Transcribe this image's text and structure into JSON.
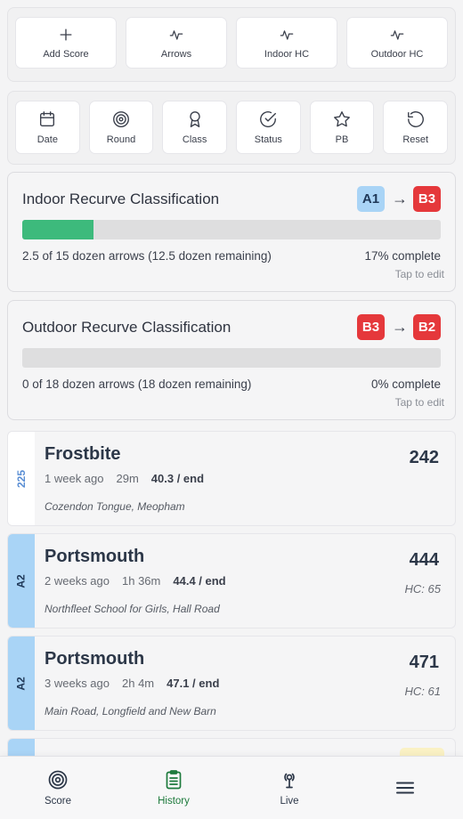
{
  "quick_actions": [
    {
      "label": "Add Score",
      "icon": "plus-icon"
    },
    {
      "label": "Arrows",
      "icon": "pulse-icon"
    },
    {
      "label": "Indoor HC",
      "icon": "pulse-icon"
    },
    {
      "label": "Outdoor HC",
      "icon": "pulse-icon"
    }
  ],
  "filters": [
    {
      "label": "Date",
      "icon": "calendar-icon"
    },
    {
      "label": "Round",
      "icon": "target-icon"
    },
    {
      "label": "Class",
      "icon": "award-icon"
    },
    {
      "label": "Status",
      "icon": "check-circle-icon"
    },
    {
      "label": "PB",
      "icon": "star-icon"
    },
    {
      "label": "Reset",
      "icon": "reset-icon"
    }
  ],
  "classifications": [
    {
      "title": "Indoor Recurve Classification",
      "from": "A1",
      "to": "B3",
      "arrow": "→",
      "progress_fraction": 0.17,
      "progress_text": "2.5 of 15 dozen arrows (12.5 dozen remaining)",
      "percent_text": "17% complete",
      "edit_text": "Tap to edit"
    },
    {
      "title": "Outdoor Recurve Classification",
      "from": "B3",
      "to": "B2",
      "arrow": "→",
      "progress_fraction": 0,
      "progress_text": "0 of 18 dozen arrows (18 dozen remaining)",
      "percent_text": "0% complete",
      "edit_text": "Tap to edit"
    }
  ],
  "scores": [
    {
      "tag": "225",
      "round": "Frostbite",
      "when": "1 week ago",
      "duration": "29m",
      "avg": "40.3 / end",
      "venue": "Cozendon Tongue, Meopham",
      "score": "242",
      "hc": ""
    },
    {
      "tag": "A2",
      "round": "Portsmouth",
      "when": "2 weeks ago",
      "duration": "1h 36m",
      "avg": "44.4 / end",
      "venue": "Northfleet School for Girls, Hall Road",
      "score": "444",
      "hc": "HC: 65"
    },
    {
      "tag": "A2",
      "round": "Portsmouth",
      "when": "3 weeks ago",
      "duration": "2h 4m",
      "avg": "47.1 / end",
      "venue": "Main Road, Longfield and New Barn",
      "score": "471",
      "hc": "HC: 61"
    }
  ],
  "nav": [
    {
      "label": "Score",
      "icon": "target-icon"
    },
    {
      "label": "History",
      "icon": "clipboard-icon",
      "active": true
    },
    {
      "label": "Live",
      "icon": "broadcast-icon"
    },
    {
      "label": "",
      "icon": "menu-icon"
    }
  ],
  "colors": {
    "accent_green": "#3dba7c",
    "badge_blue": "#a9d4f6",
    "badge_red": "#e5383b",
    "nav_active": "#1d7a3c"
  }
}
